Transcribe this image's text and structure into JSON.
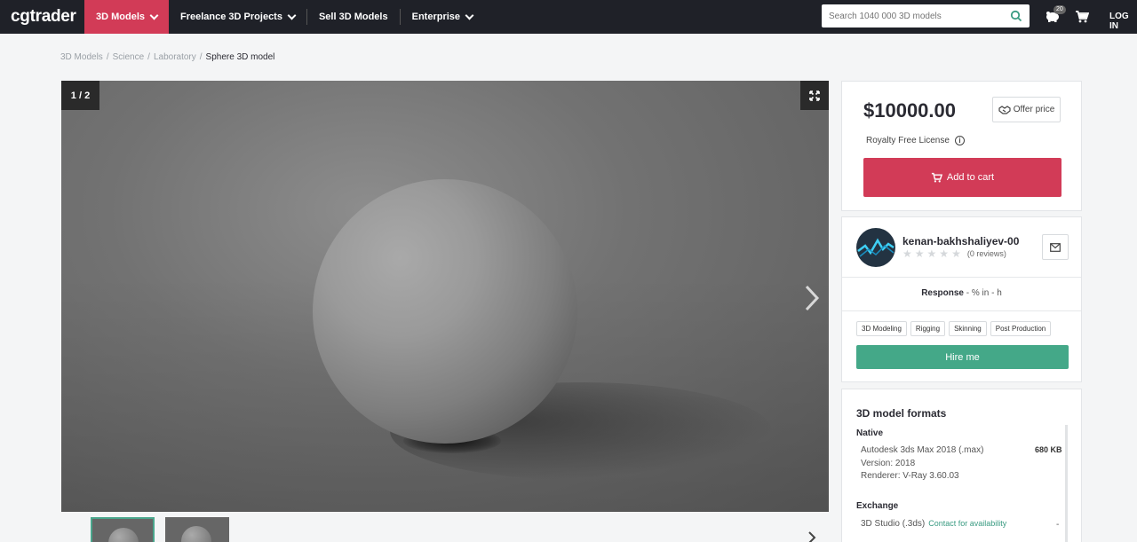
{
  "nav": {
    "logo": "cgtrader",
    "items": [
      {
        "label": "3D Models",
        "active": true,
        "dropdown": true
      },
      {
        "label": "Freelance 3D Projects",
        "active": false,
        "dropdown": true
      },
      {
        "label": "Sell 3D Models",
        "active": false,
        "dropdown": false
      },
      {
        "label": "Enterprise",
        "active": false,
        "dropdown": true
      }
    ],
    "search_placeholder": "Search 1040 000 3D models",
    "piggy_badge": "20",
    "login": "LOG IN"
  },
  "breadcrumb": [
    {
      "label": "3D Models",
      "sep": "/"
    },
    {
      "label": "Science",
      "sep": "/"
    },
    {
      "label": "Laboratory",
      "sep": "/"
    },
    {
      "label": "Sphere 3D model",
      "sep": ""
    }
  ],
  "viewer": {
    "counter": "1 / 2"
  },
  "purchase": {
    "price": "$10000.00",
    "offer_label": "Offer price",
    "license": "Royalty Free License",
    "add_to_cart": "Add to cart"
  },
  "author": {
    "name": "kenan-bakhshaliyev-00",
    "rating_stars": 0,
    "reviews": "(0 reviews)",
    "response_label": "Response",
    "response_value": " - % in - h",
    "tags": [
      "3D Modeling",
      "Rigging",
      "Skinning",
      "Post Production"
    ],
    "hire_label": "Hire me"
  },
  "formats": {
    "title": "3D model formats",
    "native_label": "Native",
    "native_name": "Autodesk 3ds Max 2018 (.max)",
    "native_size": "680 KB",
    "native_version": "Version: 2018",
    "native_renderer": "Renderer: V-Ray 3.60.03",
    "exchange_label": "Exchange",
    "exchange_name": "3D Studio (.3ds)",
    "exchange_link": "Contact for availability",
    "exchange_dash": "-"
  },
  "colors": {
    "brand_red": "#d23b57",
    "hire_green": "#44a888",
    "nav_bg": "#1f2128"
  }
}
